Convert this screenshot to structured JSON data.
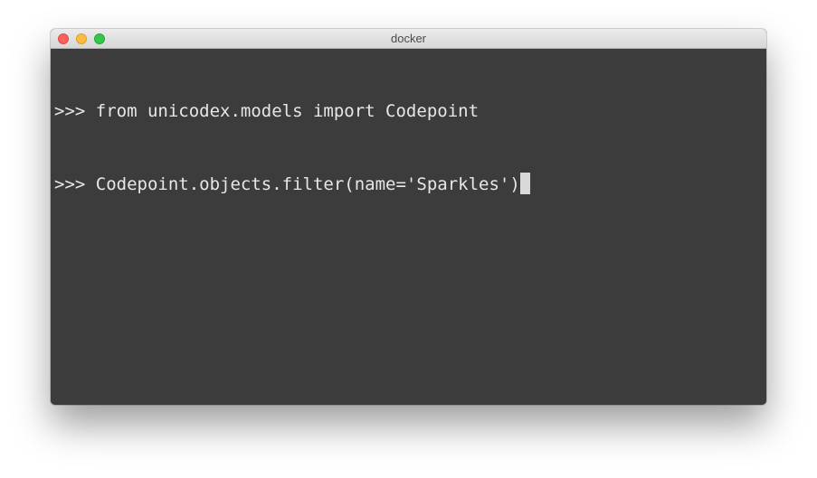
{
  "window": {
    "title": "docker",
    "controls": {
      "close_color": "#fc605c",
      "minimize_color": "#fdbc40",
      "maximize_color": "#34c84a"
    }
  },
  "terminal": {
    "background_color": "#3c3c3c",
    "text_color": "#e7e7e7",
    "lines": [
      {
        "prompt": ">>>",
        "command": " from unicodex.models import Codepoint"
      },
      {
        "prompt": ">>>",
        "command": " Codepoint.objects.filter(name='Sparkles')"
      }
    ],
    "cursor_visible": true
  }
}
